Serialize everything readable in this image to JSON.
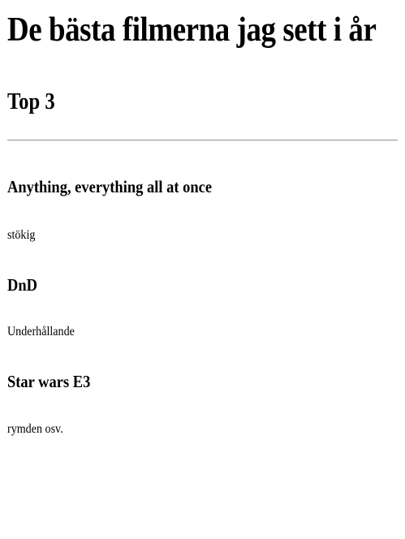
{
  "page": {
    "title": "De bästa filmerna jag sett i år",
    "section_title": "Top 3"
  },
  "movies": [
    {
      "title": "Anything, everything all at once",
      "description": "stökig"
    },
    {
      "title": "DnD",
      "description": "Underhållande"
    },
    {
      "title": "Star wars E3",
      "description": "rymden osv."
    }
  ]
}
